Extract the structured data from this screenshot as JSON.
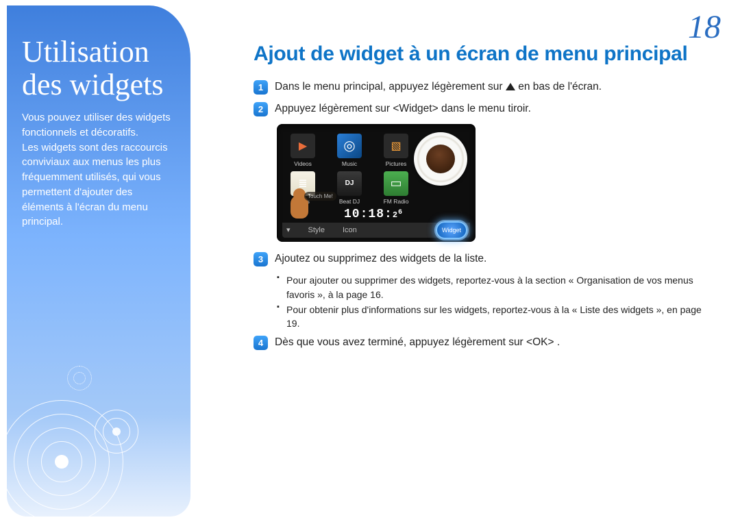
{
  "page_number": "18",
  "sidebar": {
    "title": "Utilisation\ndes widgets",
    "description": "Vous pouvez utiliser des widgets fonctionnels et décoratifs.\nLes widgets sont des raccourcis conviviaux aux menus les plus fréquemment utilisés, qui vous permettent d'ajouter des éléments à l'écran du menu principal."
  },
  "main": {
    "title": "Ajout de widget à un écran de menu principal",
    "steps": [
      {
        "n": "1",
        "text_before": "Dans le menu principal, appuyez légèrement sur ",
        "text_after": " en bas de l'écran.",
        "has_arrow": true
      },
      {
        "n": "2",
        "text": "Appuyez légèrement sur <Widget> dans le menu tiroir."
      },
      {
        "n": "3",
        "text": "Ajoutez ou supprimez des widgets de la liste.",
        "bullets": [
          "Pour ajouter ou supprimer des widgets, reportez-vous à la section « Organisation de vos menus favoris », à la page 16.",
          "Pour obtenir plus d'informations sur les widgets, reportez-vous à la « Liste des widgets », en page 19."
        ]
      },
      {
        "n": "4",
        "text": "Dès que vous avez terminé, appuyez légèrement sur <OK> ."
      }
    ]
  },
  "device": {
    "apps": [
      {
        "label": "Videos"
      },
      {
        "label": "Music"
      },
      {
        "label": "Pictures"
      },
      {
        "label": "Texts"
      },
      {
        "label": "Beat DJ"
      },
      {
        "label": "FM Radio"
      }
    ],
    "touch_bubble": "Touch Me!",
    "clock": "10:18:",
    "clock_seconds_a": "2",
    "clock_seconds_b": "6",
    "bottom_bar": {
      "style": "Style",
      "icon": "Icon"
    },
    "widget_chip": "Widget"
  }
}
